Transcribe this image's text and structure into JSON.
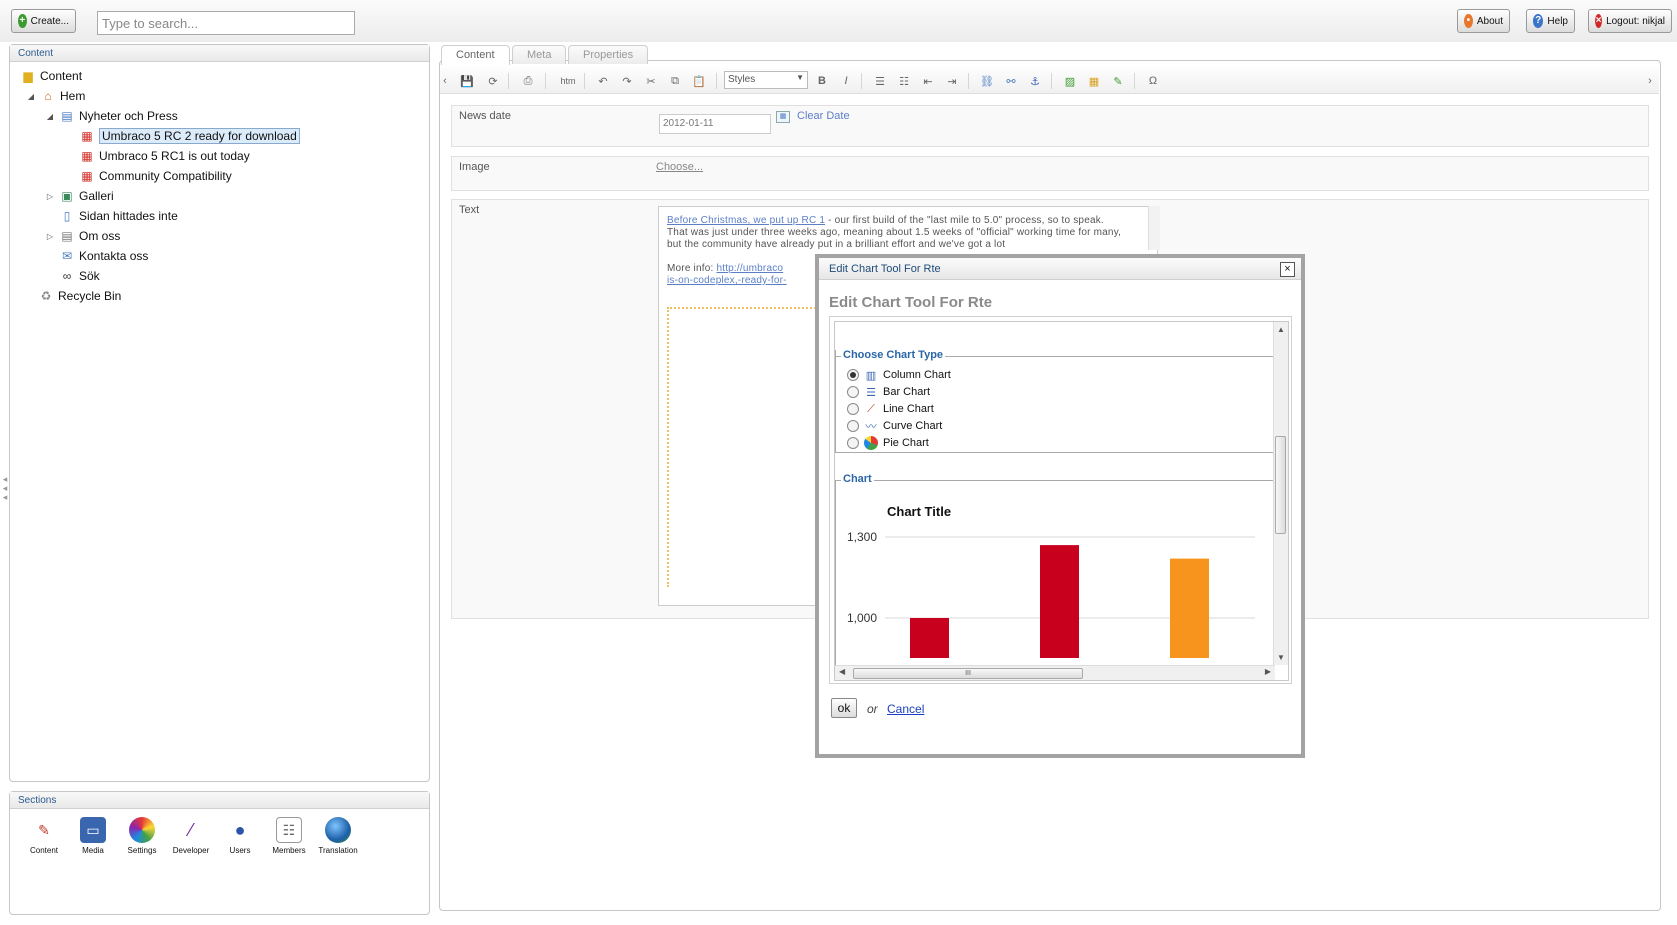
{
  "topbar": {
    "create_label": "Create...",
    "search_placeholder": "Type to search...",
    "about_label": "About",
    "help_label": "Help",
    "logout_label": "Logout: nikjal"
  },
  "content_panel": {
    "title": "Content",
    "tree": [
      {
        "label": "Content",
        "icon": "folder-icon"
      },
      {
        "label": "Hem",
        "icon": "home-icon"
      },
      {
        "label": "Nyheter och Press",
        "icon": "news-folder-icon"
      },
      {
        "label": "Umbraco 5 RC 2 ready for download",
        "icon": "calendar-icon",
        "selected": true
      },
      {
        "label": "Umbraco 5 RC1 is out today",
        "icon": "calendar-icon"
      },
      {
        "label": "Community Compatibility",
        "icon": "calendar-icon"
      },
      {
        "label": "Galleri",
        "icon": "gallery-icon"
      },
      {
        "label": "Sidan hittades inte",
        "icon": "page-error-icon"
      },
      {
        "label": "Om oss",
        "icon": "page-icon"
      },
      {
        "label": "Kontakta oss",
        "icon": "mail-icon"
      },
      {
        "label": "Sök",
        "icon": "binoculars-icon"
      },
      {
        "label": "Recycle Bin",
        "icon": "recycle-bin-icon"
      }
    ]
  },
  "sections_panel": {
    "title": "Sections",
    "items": [
      {
        "label": "Content",
        "icon": "content-icon"
      },
      {
        "label": "Media",
        "icon": "media-icon"
      },
      {
        "label": "Settings",
        "icon": "settings-icon"
      },
      {
        "label": "Developer",
        "icon": "developer-icon"
      },
      {
        "label": "Users",
        "icon": "users-icon"
      },
      {
        "label": "Members",
        "icon": "members-icon"
      },
      {
        "label": "Translation",
        "icon": "translation-icon"
      }
    ]
  },
  "editor": {
    "tabs": [
      "Content",
      "Meta",
      "Properties"
    ],
    "styles_label": "Styles",
    "news_date_label": "News date",
    "news_date_value": "2012-01-11",
    "clear_date_label": "Clear Date",
    "image_label": "Image",
    "choose_label": "Choose...",
    "text_label": "Text",
    "rte_link": "Before Christmas, we put up RC 1",
    "rte_text": " - our first build of the \"last mile to 5.0\" process, so to speak. That was just under three weeks ago, meaning about 1.5 weeks of \"official\" working time for many, but the community have already put in a brilliant effort and we've got a lot",
    "more_info_label": "More info:",
    "more_info_link": "http://umbraco",
    "more_info_link2": "is-on-codeplex,-ready-for-"
  },
  "modal": {
    "title": "Edit Chart Tool For Rte",
    "heading": "Edit Chart Tool For Rte",
    "chart_type_legend": "Choose Chart Type",
    "chart_types": [
      {
        "label": "Column Chart",
        "icon": "column-chart-icon",
        "checked": true
      },
      {
        "label": "Bar Chart",
        "icon": "bar-chart-icon",
        "checked": false
      },
      {
        "label": "Line Chart",
        "icon": "line-chart-icon",
        "checked": false
      },
      {
        "label": "Curve Chart",
        "icon": "curve-chart-icon",
        "checked": false
      },
      {
        "label": "Pie Chart",
        "icon": "pie-chart-icon",
        "checked": false
      }
    ],
    "chart_legend": "Chart",
    "ok_label": "ok",
    "or_label": "or",
    "cancel_label": "Cancel",
    "hscroll_grip": "III",
    "close_label": "×"
  },
  "chart_data": {
    "type": "bar",
    "title": "Chart Title",
    "y_ticks": [
      "1,300",
      "1,000"
    ],
    "ylim": [
      1000,
      1300
    ],
    "values": [
      1000,
      1270,
      1220
    ],
    "colors": [
      "#c8001e",
      "#c8001e",
      "#f7941d"
    ],
    "categories": [
      "",
      "",
      ""
    ],
    "xlabel": "",
    "ylabel": "",
    "legend": "none",
    "grid": true
  },
  "colors": {
    "accent": "#2a66a8",
    "selected_bg": "#dcebfa",
    "modal_border": "#a3a3a3"
  }
}
